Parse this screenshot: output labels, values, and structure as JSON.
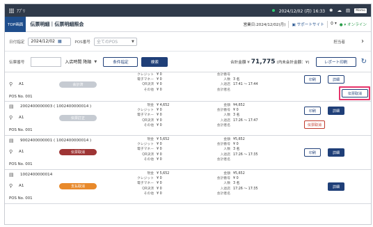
{
  "statusbar": {
    "app_name": "ｱﾌﾟﾘ",
    "datetime": "2024/12/02 (月) 16:33",
    "memo": "Memo"
  },
  "header": {
    "badge": "TOP画面",
    "title": "伝票明細｜伝票明細照会",
    "business_date": "営業日:2024/12/02(月)",
    "support": "サポートサイト",
    "online": "オンライン"
  },
  "filter": {
    "date_label": "日付指定",
    "date_value": "2024/12/02",
    "pos_label": "POS番号",
    "pos_value": "全てのPOS",
    "staff_label": "担当者"
  },
  "search": {
    "receipt_label": "伝票番号",
    "receipt_value": "",
    "sort_label": "入店時間 降順",
    "condition_button": "条件指定",
    "search_button": "検索",
    "total_label": "合計金額 ¥",
    "total_value": "71,775",
    "total_suffix": "(内未会計金額：¥)",
    "report_button": "レポート印刷"
  },
  "icons": {
    "grid": "apps-grid-icon",
    "calendar": "calendar-icon",
    "refresh": "refresh-icon",
    "receipt": "receipt-icon",
    "table": "table-icon"
  },
  "colors": {
    "accent": "#1f3f78",
    "highlight": "#e6336a",
    "status_red": "#9e3535",
    "status_orange": "#e8892a",
    "status_gray": "#c6cbd2"
  },
  "rows": [
    {
      "receipt": "",
      "table": "A1",
      "pos": "POS No. 001",
      "status": "会計済",
      "left_kv": [
        [
          "クレジット",
          "¥ 0"
        ],
        [
          "電子マネー",
          "¥ 0"
        ],
        [
          "QR決済",
          "¥ 0"
        ],
        [
          "その他",
          "¥ 0"
        ]
      ],
      "right_kv": [
        [
          "会計番号",
          ""
        ],
        [
          "人数",
          "3 名"
        ],
        [
          "入退店",
          "17:41 ～ 17:44"
        ],
        [
          "会計者名",
          ""
        ]
      ],
      "buttons": [
        "印刷",
        "詳細",
        "伝票取消"
      ]
    },
    {
      "receipt": "2002400000003 ( 1002400000014 )",
      "table": "A1",
      "pos": "POS No. 001",
      "status": "伝票訂正",
      "left_kv": [
        [
          "現金",
          "¥ 4,652"
        ],
        [
          "クレジット",
          "¥ 0"
        ],
        [
          "電子マネー",
          "¥ 0"
        ],
        [
          "QR決済",
          "¥ 0"
        ],
        [
          "その他",
          "¥ 0"
        ]
      ],
      "right_kv": [
        [
          "金額",
          "¥4,652"
        ],
        [
          "会計番号",
          "¥ 0"
        ],
        [
          "人数",
          "3 名"
        ],
        [
          "入退店",
          "17:26 ～ 17:47"
        ],
        [
          "会計者名",
          ""
        ]
      ],
      "buttons": [
        "印刷",
        "詳細",
        "伝票取消"
      ]
    },
    {
      "receipt": "9002400000001 ( 1002400000014 )",
      "table": "A1",
      "pos": "POS No. 001",
      "status": "伝票取消",
      "left_kv": [
        [
          "現金",
          "¥ 5,652"
        ],
        [
          "クレジット",
          "¥ 0"
        ],
        [
          "電子マネー",
          "¥ 0"
        ],
        [
          "QR決済",
          "¥ 0"
        ],
        [
          "その他",
          "¥ 0"
        ]
      ],
      "right_kv": [
        [
          "金額",
          "¥5,652"
        ],
        [
          "会計番号",
          "¥ 0"
        ],
        [
          "人数",
          "3 名"
        ],
        [
          "入退店",
          "17:26 ～ 17:35"
        ],
        [
          "会計者名",
          ""
        ]
      ],
      "buttons": [
        "印刷",
        "詳細"
      ]
    },
    {
      "receipt": "1002400000014",
      "table": "A1",
      "pos": "POS No. 001",
      "status": "支払取消",
      "left_kv": [
        [
          "現金",
          "¥ 5,652"
        ],
        [
          "クレジット",
          "¥ 0"
        ],
        [
          "電子マネー",
          "¥ 0"
        ],
        [
          "QR決済",
          "¥ 0"
        ],
        [
          "その他",
          "¥ 0"
        ]
      ],
      "right_kv": [
        [
          "金額",
          "¥5,652"
        ],
        [
          "会計番号",
          "¥ 0"
        ],
        [
          "人数",
          "3 名"
        ],
        [
          "入退店",
          "17:26 ～ 17:35"
        ],
        [
          "会計者名",
          ""
        ]
      ],
      "buttons": [
        "詳細"
      ]
    }
  ]
}
